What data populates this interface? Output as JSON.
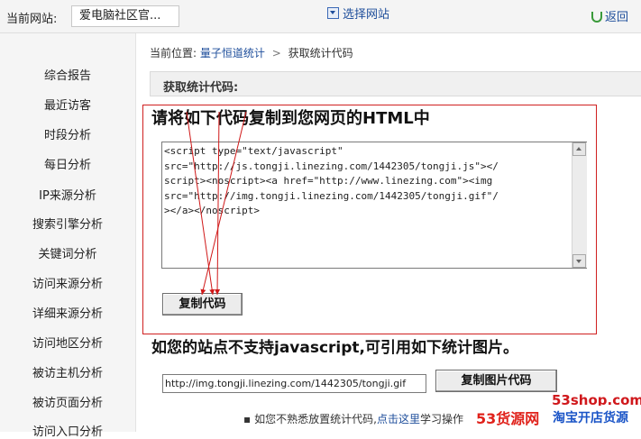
{
  "topbar": {
    "current_site_label": "当前网站:",
    "current_site_value": "爱电脑社区官...",
    "choose_site": "选择网站",
    "return_link": "返回"
  },
  "sidebar": {
    "items": [
      {
        "label": "综合报告"
      },
      {
        "label": "最近访客"
      },
      {
        "label": "时段分析"
      },
      {
        "label": "每日分析"
      },
      {
        "label": "IP来源分析"
      },
      {
        "label": "搜索引擎分析"
      },
      {
        "label": "关键词分析"
      },
      {
        "label": "访问来源分析"
      },
      {
        "label": "详细来源分析"
      },
      {
        "label": "访问地区分析"
      },
      {
        "label": "被访主机分析"
      },
      {
        "label": "被访页面分析"
      },
      {
        "label": "访问入口分析"
      }
    ]
  },
  "breadcrumb": {
    "prefix": "当前位置:",
    "link": "量子恒道统计",
    "separator": ">",
    "current": "获取统计代码"
  },
  "section": {
    "title": "获取统计代码:"
  },
  "code_block": {
    "instruction": "请将如下代码复制到您网页的HTML中",
    "code": "<script type=\"text/javascript\"\nsrc=\"http://js.tongji.linezing.com/1442305/tongji.js\"></\nscript><noscript><a href=\"http://www.linezing.com\"><img\nsrc=\"http://img.tongji.linezing.com/1442305/tongji.gif\"/\n></a></noscript>",
    "copy_button": "复制代码"
  },
  "image_code": {
    "instruction": "如您的站点不支持javascript,可引用如下统计图片。",
    "url": "http://img.tongji.linezing.com/1442305/tongji.gif",
    "copy_button": "复制图片代码"
  },
  "help": {
    "text_before": "如您不熟悉放置统计代码,",
    "link": "点击这里",
    "text_after": "学习操作"
  },
  "watermark": {
    "top": "53shop.com",
    "bottom_left": "53货源网",
    "bottom_right": "淘宝开店货源"
  },
  "colors": {
    "link": "#1e4e9b",
    "highlight_box": "#d02020",
    "sidebar_bg": "#f5f5f5"
  }
}
